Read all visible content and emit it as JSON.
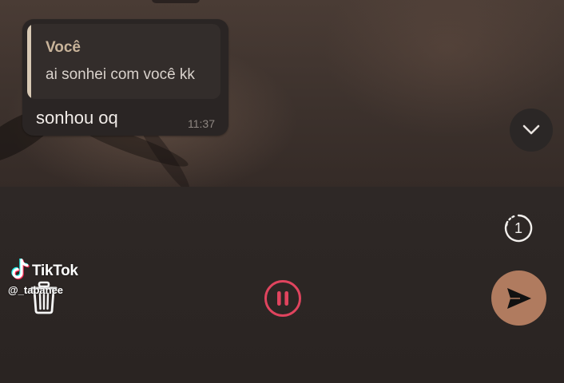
{
  "chat": {
    "message": {
      "quote_author": "Você",
      "quote_text": "ai sonhei com você kk",
      "text": "sonhou oq",
      "time": "11:37"
    }
  },
  "controls": {
    "scroll_down_icon": "chevron-down-icon",
    "view_once_label": "1",
    "delete_icon": "trash-icon",
    "pause_icon": "pause-icon",
    "send_icon": "send-icon"
  },
  "watermark": {
    "brand": "TikTok",
    "handle": "@_tabanee"
  },
  "colors": {
    "accent_send": "#b07b5f",
    "pause_ring": "#e0445e",
    "quote_author": "#c9b49a"
  }
}
